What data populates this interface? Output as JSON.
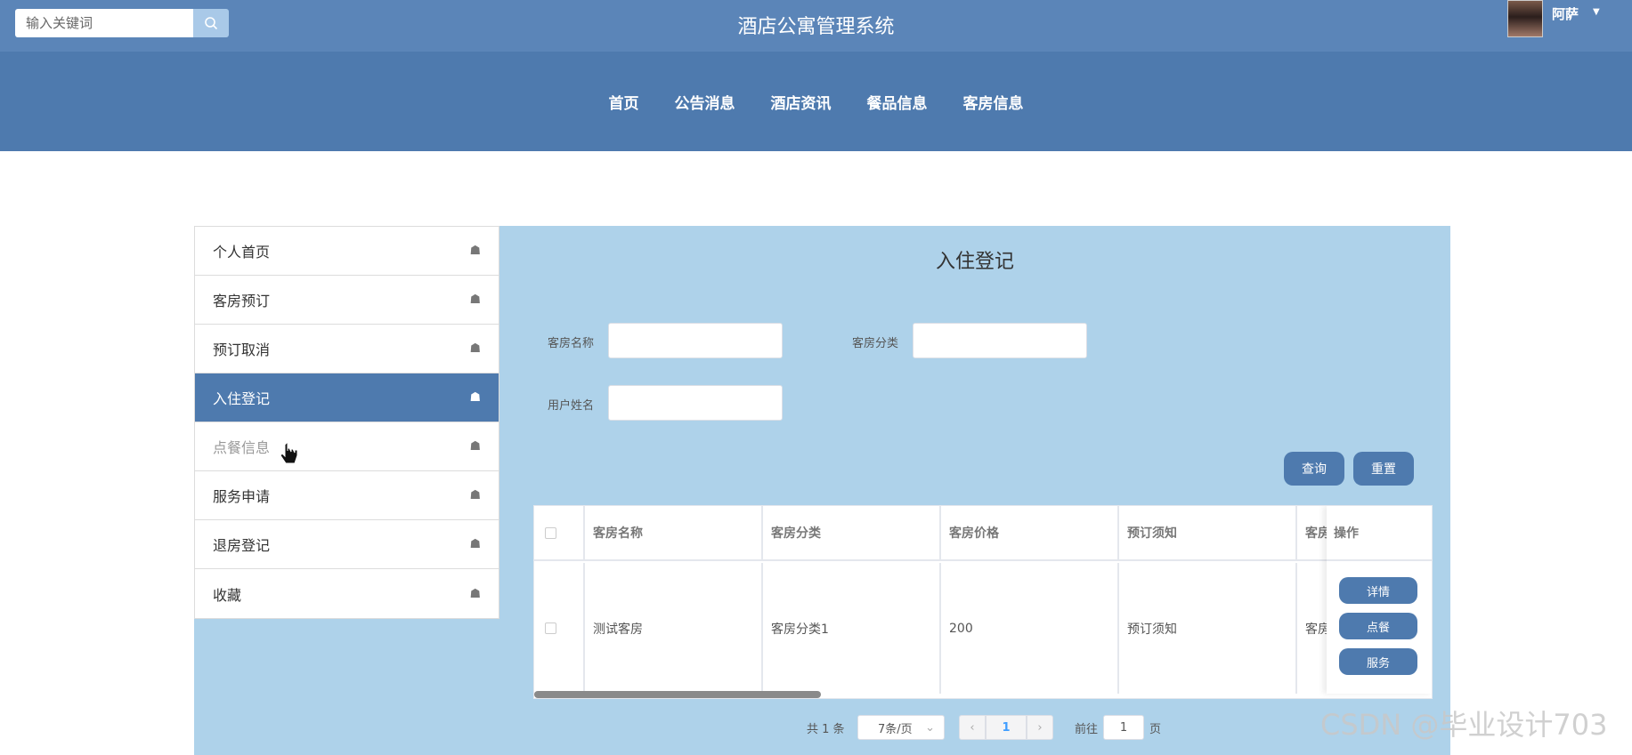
{
  "header": {
    "search_placeholder": "输入关键词",
    "app_title": "酒店公寓管理系统",
    "username": "阿萨",
    "caret": "▼"
  },
  "nav": [
    {
      "label": "首页"
    },
    {
      "label": "公告消息"
    },
    {
      "label": "酒店资讯"
    },
    {
      "label": "餐品信息"
    },
    {
      "label": "客房信息"
    }
  ],
  "sidebar": {
    "items": [
      {
        "label": "个人首页"
      },
      {
        "label": "客房预订"
      },
      {
        "label": "预订取消"
      },
      {
        "label": "入住登记"
      },
      {
        "label": "点餐信息"
      },
      {
        "label": "服务申请"
      },
      {
        "label": "退房登记"
      },
      {
        "label": "收藏"
      }
    ],
    "active_index": 3,
    "icon_glyph": "☗"
  },
  "content": {
    "title": "入住登记",
    "filters": {
      "room_name_label": "客房名称",
      "room_type_label": "客房分类",
      "user_name_label": "用户姓名"
    },
    "buttons": {
      "search": "查询",
      "reset": "重置"
    },
    "table": {
      "headers": [
        "客房名称",
        "客房分类",
        "客房价格",
        "预订须知",
        "客房"
      ],
      "ops_header": "操作",
      "rows": [
        {
          "cells": [
            "测试客房",
            "客房分类1",
            "200",
            "预订须知",
            "客房"
          ]
        }
      ],
      "row_actions": [
        "详情",
        "点餐",
        "服务"
      ]
    },
    "pagination": {
      "total": "共 1 条",
      "page_size": "7条/页",
      "current_page": "1",
      "goto_label": "前往",
      "goto_value": "1",
      "page_suffix": "页",
      "prev": "‹",
      "next": "›",
      "dropdown": "⌄"
    }
  },
  "watermark": "CSDN @毕业设计703",
  "colors": {
    "topbar": "#5b85b8",
    "navbar": "#4e7aae",
    "panel": "#aed2ea",
    "accent": "#4e7aae",
    "active_page": "#409eff"
  }
}
